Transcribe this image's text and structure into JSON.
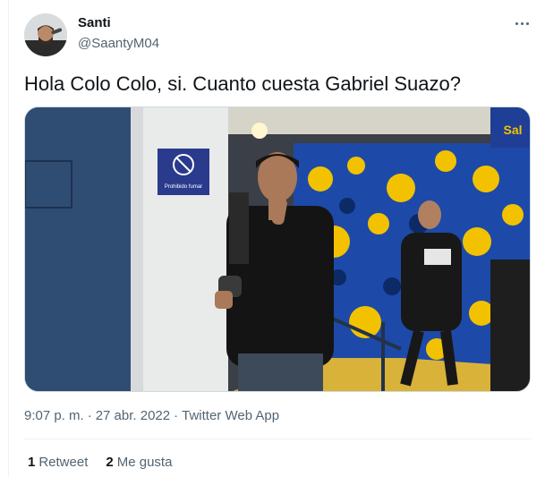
{
  "author": {
    "display_name": "Santi",
    "handle": "@SaantyM04"
  },
  "tweet": {
    "text": "Hola Colo Colo, si. Cuanto cuesta Gabriel Suazo?",
    "time": "9:07 p. m.",
    "date": "27 abr. 2022",
    "separator": "·",
    "client": "Twitter Web App"
  },
  "media": {
    "sign_text": "Prohibido fumar",
    "wall_text": "Sal"
  },
  "stats": {
    "retweets_count": "1",
    "retweets_label": "Retweet",
    "likes_count": "2",
    "likes_label": "Me gusta"
  },
  "colors": {
    "text_primary": "#0f1419",
    "text_secondary": "#536471",
    "border": "#cfd9de",
    "mural_blue": "#1d4aa8",
    "mural_yellow": "#f2c200"
  },
  "icons": {
    "more": "ellipsis-icon"
  }
}
